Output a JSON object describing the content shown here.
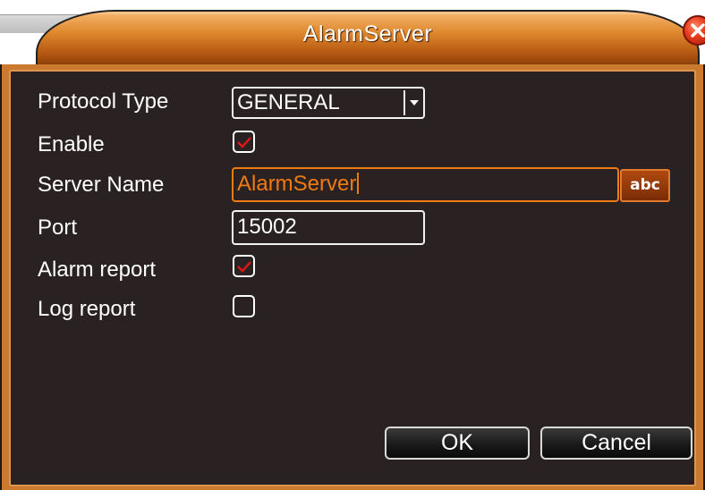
{
  "dialog": {
    "title": "AlarmServer",
    "close_icon": "close-icon"
  },
  "form": {
    "protocol_type": {
      "label": "Protocol Type",
      "value": "GENERAL"
    },
    "enable": {
      "label": "Enable",
      "checked": true
    },
    "server_name": {
      "label": "Server Name",
      "value": "AlarmServer",
      "keyboard_button": "abc"
    },
    "port": {
      "label": "Port",
      "value": "15002"
    },
    "alarm_report": {
      "label": "Alarm report",
      "checked": true
    },
    "log_report": {
      "label": "Log report",
      "checked": false
    }
  },
  "buttons": {
    "ok": "OK",
    "cancel": "Cancel"
  },
  "colors": {
    "accent": "#f07a12",
    "frame": "#c97a2e",
    "panel": "#2a2222",
    "check": "#e01818"
  }
}
